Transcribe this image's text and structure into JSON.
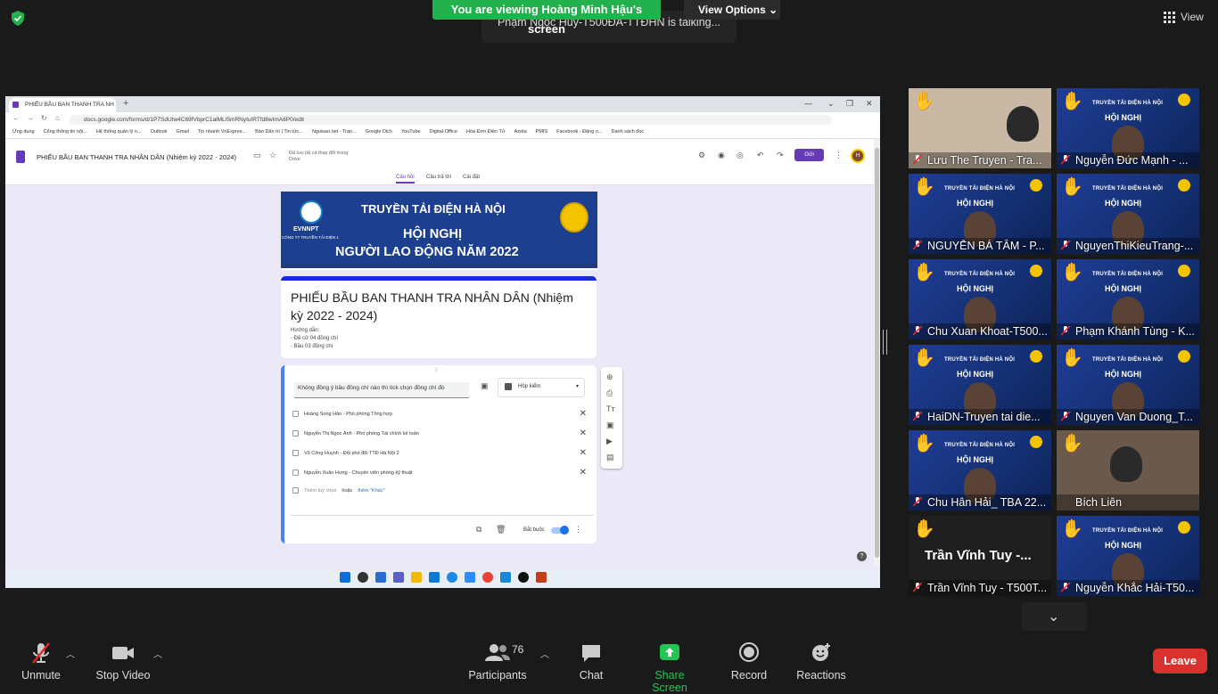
{
  "top": {
    "share_banner": "You are viewing Hoàng Minh Hậu's screen",
    "view_options": "View Options",
    "talking": "Phạm Ngọc Huy-T500ĐA-TTĐHN is talking...",
    "view_label": "View"
  },
  "browser": {
    "tab_title": "PHIẾU BẦU BAN THANH TRA NH",
    "url": "docs.google.com/forms/d/1P7SdUtw4C69fVbprC1alMLI5mRNyIuIRTfd8wImA6P0/edit",
    "bookmarks": [
      "Ứng dụng",
      "Cổng thông tin nội...",
      "Hệ thống quản lý n...",
      "Outlook",
      "Gmail",
      "Tin nhanh VnExpres...",
      "Báo Dân trí | Tin tức...",
      "Ngoisao.net - Tran...",
      "Google Dịch",
      "YouTube",
      "Digital-Office",
      "Hóa Đơn Điện Tử",
      "Azota",
      "PMIS",
      "Facebook - Đăng n...",
      "Danh sách đọc"
    ]
  },
  "forms": {
    "doc_title": "PHIẾU BẦU BAN THANH TRA NHÂN DÂN (Nhiệm kỳ 2022 - 2024)",
    "saved_note": "Đã lưu tất cả thay đổi trong Drive",
    "send": "Gửi",
    "user_initial": "H",
    "tabs": {
      "questions": "Câu hỏi",
      "responses": "Câu trả lời",
      "settings": "Cài đặt"
    },
    "banner": {
      "company": "TRUYỀN TẢI ĐIỆN HÀ NỘI",
      "line1": "HỘI NGHỊ",
      "line2": "NGƯỜI LAO ĐỘNG NĂM 2022",
      "evn": "EVNNPT",
      "evn_sub": "CÔNG TY TRUYỀN TẢI ĐIỆN 1"
    },
    "title": "PHIẾU BẦU BAN THANH TRA NHÂN DÂN (Nhiệm kỳ 2022 - 2024)",
    "desc": [
      "Hướng dẫn:",
      "- Đề cử 04 đồng chí",
      "- Bầu 03 đồng chí"
    ],
    "question": "Không đồng ý bầu đồng chí nào thì tick chọn đồng chí đó",
    "question_type": "Hộp kiểm",
    "options": [
      "Hoàng Song Hảo - Phó phòng Tổng hợp",
      "Nguyễn Thị Ngọc Ánh - Phó phòng Tài chính kế toán",
      "Vũ Công Huynh - Đội phó đội TTĐ Hà Nội 2",
      "Nguyễn Xuân Hưng - Chuyên viên phòng kỹ thuật"
    ],
    "add_option": "Thêm tùy chọn",
    "or": "hoặc",
    "add_other": "thêm \"Khác\"",
    "required": "Bắt buộc"
  },
  "participants": [
    {
      "name": "Lưu The Truyen - Tra...",
      "hand": true,
      "muted": true,
      "bg": "photo"
    },
    {
      "name": "Nguyễn Đức Mạnh - ...",
      "hand": true,
      "muted": true,
      "bg": "banner"
    },
    {
      "name": "NGUYỄN BÁ TÂM - P...",
      "hand": true,
      "muted": true,
      "bg": "banner"
    },
    {
      "name": "NguyenThiKieuTrang-...",
      "hand": true,
      "muted": true,
      "bg": "banner"
    },
    {
      "name": "Chu Xuan Khoat-T500...",
      "hand": true,
      "muted": true,
      "bg": "banner"
    },
    {
      "name": "Phạm Khánh Tùng - K...",
      "hand": true,
      "muted": true,
      "bg": "banner"
    },
    {
      "name": "HaiDN-Truyen tai die...",
      "hand": true,
      "muted": true,
      "bg": "banner"
    },
    {
      "name": "Nguyen Van Duong_T...",
      "hand": true,
      "muted": true,
      "bg": "banner"
    },
    {
      "name": "Chu Hân Hải_ TBA 22...",
      "hand": true,
      "muted": true,
      "bg": "banner"
    },
    {
      "name": "Bích Liên",
      "hand": true,
      "muted": false,
      "bg": "photo"
    },
    {
      "name": "Trần Vĩnh Tuy - T500T...",
      "hand": true,
      "muted": true,
      "bg": "dark"
    },
    {
      "name": "Nguyễn Khắc Hải-T50...",
      "hand": true,
      "muted": true,
      "bg": "banner"
    }
  ],
  "big_name": "Trần Vĩnh Tuy -...",
  "tile_banner": {
    "hdr": "TRUYỀN TẢI ĐIỆN HÀ NỘI",
    "conf": "HỘI NGHỊ"
  },
  "toolbar": {
    "unmute": "Unmute",
    "stop_video": "Stop Video",
    "participants": "Participants",
    "participants_count": "76",
    "chat": "Chat",
    "share_screen": "Share Screen",
    "record": "Record",
    "reactions": "Reactions",
    "leave": "Leave"
  },
  "colors": {
    "green": "#23b14d",
    "leave": "#d9312e",
    "forms_purple": "#673ab7"
  }
}
